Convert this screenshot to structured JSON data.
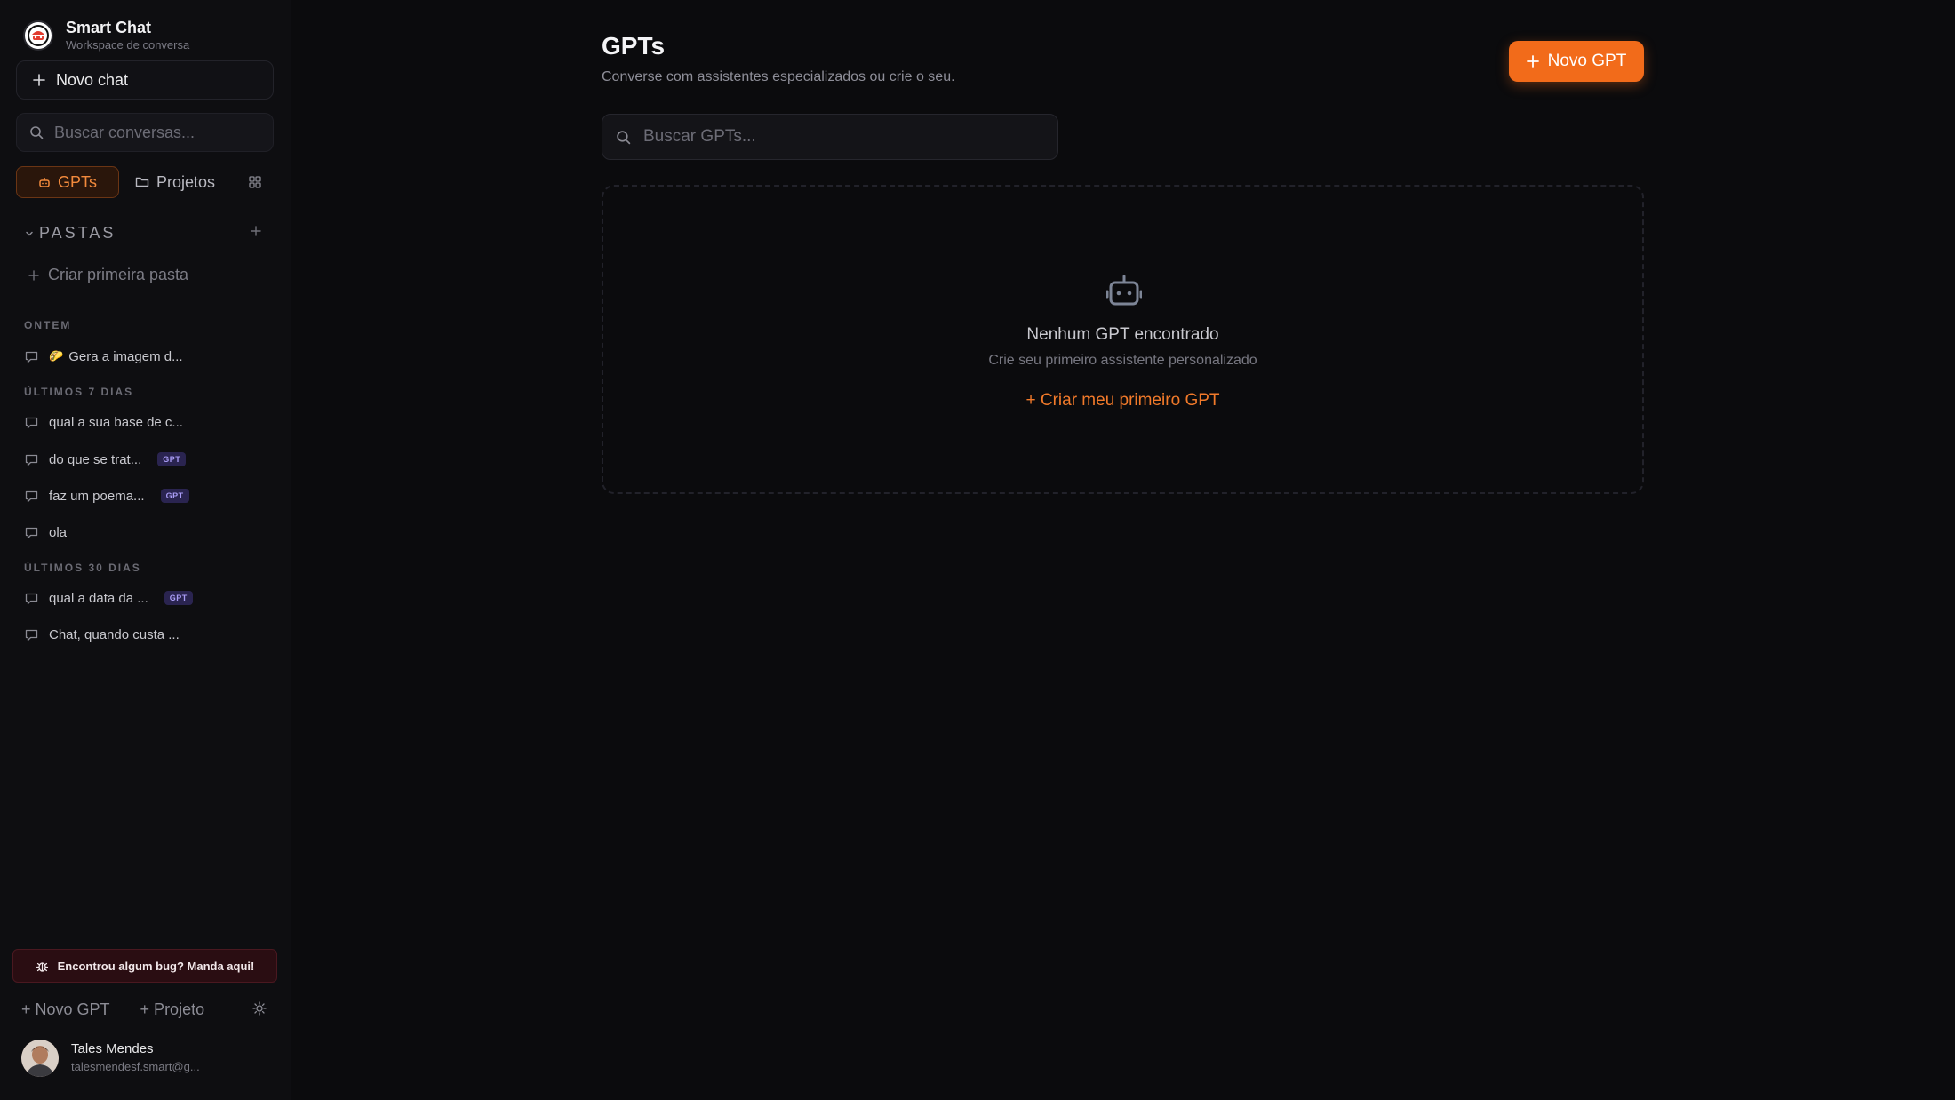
{
  "app": {
    "name": "Smart Chat",
    "subtitle": "Workspace de conversa"
  },
  "sidebar": {
    "new_chat_label": "Novo chat",
    "search_placeholder": "Buscar conversas...",
    "tabs": [
      {
        "label": "GPTs",
        "active": true
      },
      {
        "label": "Projetos",
        "active": false
      }
    ],
    "folders": {
      "title": "PASTAS",
      "create_label": "Criar primeira pasta"
    },
    "groups": [
      {
        "label": "ONTEM",
        "items": [
          {
            "title": "Gera a imagem d...",
            "emoji": "🌮",
            "badge": ""
          }
        ]
      },
      {
        "label": "ÚLTIMOS 7 DIAS",
        "items": [
          {
            "title": "qual a sua base de c...",
            "badge": ""
          },
          {
            "title": "do que se trat...",
            "badge": "GPT"
          },
          {
            "title": "faz um poema...",
            "badge": "GPT"
          },
          {
            "title": "ola",
            "badge": ""
          }
        ]
      },
      {
        "label": "ÚLTIMOS 30 DIAS",
        "items": [
          {
            "title": "qual a data da ...",
            "badge": "GPT"
          },
          {
            "title": "Chat, quando custa ...",
            "badge": ""
          }
        ]
      }
    ],
    "bug_report_label": "Encontrou algum bug? Manda aqui!",
    "bottom_actions": {
      "new_gpt": "+ Novo GPT",
      "project": "+ Projeto"
    },
    "user": {
      "name": "Tales Mendes",
      "email": "talesmendesf.smart@g..."
    }
  },
  "main": {
    "title": "GPTs",
    "subtitle": "Converse com assistentes especializados ou crie o seu.",
    "new_gpt_button": "Novo GPT",
    "search_placeholder": "Buscar GPTs...",
    "empty_state": {
      "title": "Nenhum GPT encontrado",
      "subtitle": "Crie seu primeiro assistente personalizado",
      "cta": "+ Criar meu primeiro GPT"
    }
  },
  "colors": {
    "accent": "#f26b1a",
    "background": "#0b0b0d",
    "sidebar": "#0e0e11",
    "badge_bg": "#2a2450",
    "bug_bg": "#2a0d12"
  }
}
